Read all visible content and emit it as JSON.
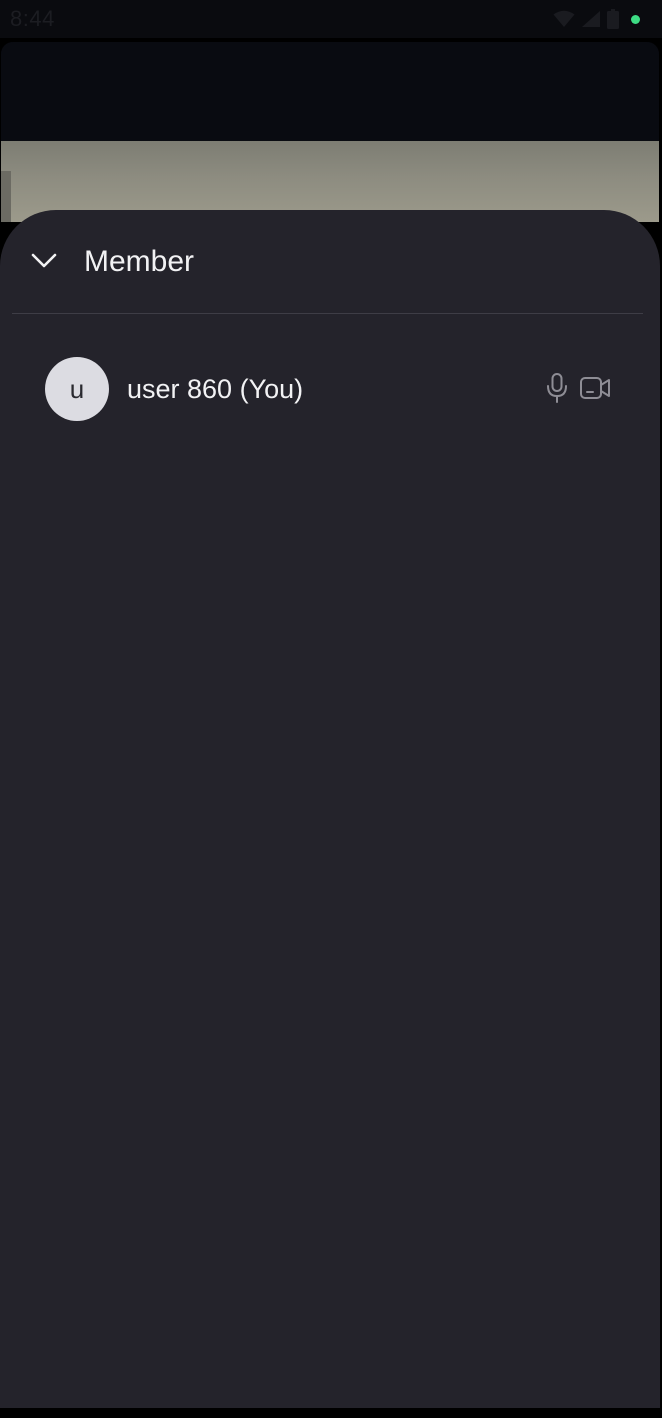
{
  "status_bar": {
    "time": "8:44",
    "icons": [
      "wifi-icon",
      "cellular-signal-icon",
      "battery-icon",
      "camera-in-use-dot"
    ],
    "indicator_color": "#3ddc84"
  },
  "sheet": {
    "collapse_icon": "chevron-down-icon",
    "title": "Member"
  },
  "members": [
    {
      "avatar_initial": "u",
      "name": "user 860 (You)",
      "mic_icon": "microphone-icon",
      "camera_icon": "video-camera-icon"
    }
  ],
  "colors": {
    "sheet_background": "#24232b",
    "avatar_background": "#dcdce2",
    "icon_muted": "#8e8d95",
    "text_primary": "#f2f2f4"
  }
}
